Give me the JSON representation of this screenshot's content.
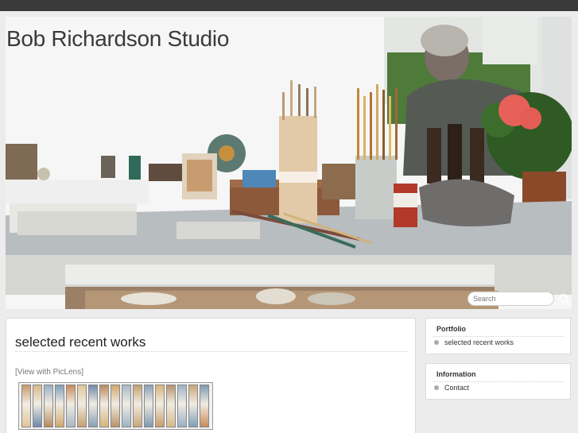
{
  "site": {
    "title": "Bob Richardson Studio"
  },
  "search": {
    "placeholder": "Search"
  },
  "main": {
    "heading": "selected recent works",
    "piclens_link": "[View with PicLens]",
    "thumbnail_count": 17
  },
  "sidebar": {
    "portfolio": {
      "title": "Portfolio",
      "items": [
        "selected recent works"
      ]
    },
    "information": {
      "title": "Information",
      "items": [
        "Contact"
      ]
    }
  },
  "colors": {
    "topbar": "#3a3a3a",
    "page_bg": "#ececec",
    "accent_flower": "#e8605a"
  }
}
